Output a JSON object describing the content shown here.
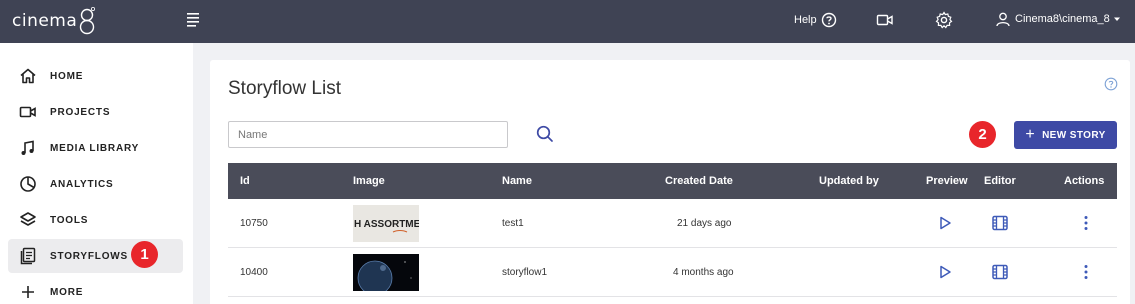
{
  "brand": {
    "logo_text": "cinema"
  },
  "header": {
    "help_label": "Help",
    "user_label": "Cinema8\\cinema_8"
  },
  "sidebar": {
    "items": [
      {
        "label": "HOME",
        "icon": "home-icon"
      },
      {
        "label": "PROJECTS",
        "icon": "video-camera-icon"
      },
      {
        "label": "MEDIA LIBRARY",
        "icon": "music-note-icon"
      },
      {
        "label": "ANALYTICS",
        "icon": "pie-chart-icon"
      },
      {
        "label": "TOOLS",
        "icon": "layers-icon"
      },
      {
        "label": "STORYFLOWS",
        "icon": "storyflow-icon",
        "active": true
      },
      {
        "label": "MORE",
        "icon": "plus-icon"
      }
    ]
  },
  "annotations": {
    "badge1": "1",
    "badge2": "2"
  },
  "main": {
    "title": "Storyflow List",
    "search": {
      "placeholder": "Name",
      "value": ""
    },
    "new_story_label": "NEW STORY",
    "table": {
      "columns": [
        "Id",
        "Image",
        "Name",
        "Created Date",
        "Updated by",
        "Preview",
        "Editor",
        "Actions"
      ],
      "rows": [
        {
          "id": "10750",
          "name": "test1",
          "created": "21 days ago",
          "updated_by": "",
          "thumb": "assortment",
          "thumb_text": "H ASSORTMENT"
        },
        {
          "id": "10400",
          "name": "storyflow1",
          "created": "4 months ago",
          "updated_by": "",
          "thumb": "earth"
        }
      ]
    }
  },
  "colors": {
    "topbar": "#3f4354",
    "accent": "#3e4aa5",
    "badge": "#e8262b",
    "table_header": "#4a4c59"
  }
}
